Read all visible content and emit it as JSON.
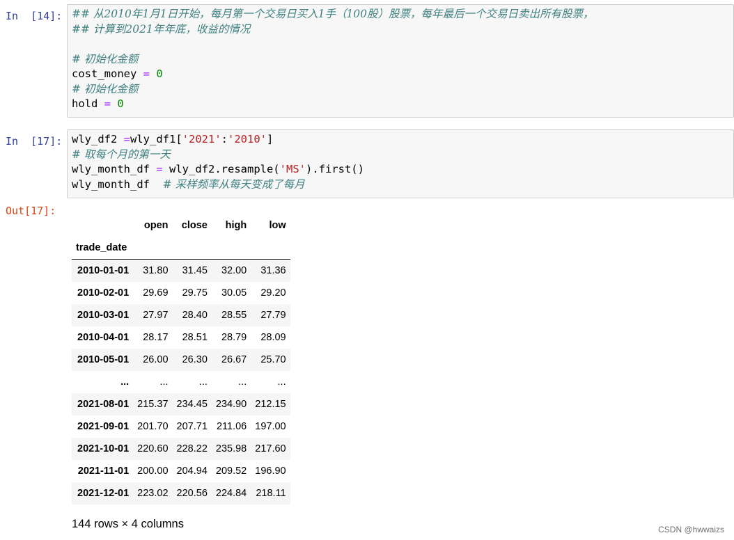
{
  "cell14": {
    "prompt": "In  [14]:",
    "lines": [
      [
        {
          "t": "## 从2010年1月1日开始，每月第一个交易日买入1手（100股）股票，每年最后一个交易日卖出所有股票，",
          "c": "cm-comment"
        }
      ],
      [
        {
          "t": "## 计算到2021年年底，收益的情况",
          "c": "cm-comment"
        }
      ],
      [],
      [
        {
          "t": "# 初始化金额",
          "c": "cm-comment"
        }
      ],
      [
        {
          "t": "cost_money ",
          "c": ""
        },
        {
          "t": "=",
          "c": "cm-op"
        },
        {
          "t": " ",
          "c": ""
        },
        {
          "t": "0",
          "c": "cm-num"
        }
      ],
      [
        {
          "t": "# 初始化金额",
          "c": "cm-comment"
        }
      ],
      [
        {
          "t": "hold ",
          "c": ""
        },
        {
          "t": "=",
          "c": "cm-op"
        },
        {
          "t": " ",
          "c": ""
        },
        {
          "t": "0",
          "c": "cm-num"
        }
      ]
    ]
  },
  "cell17": {
    "prompt": "In  [17]:",
    "out_prompt": "Out[17]:",
    "lines": [
      [
        {
          "t": "wly_df2 ",
          "c": ""
        },
        {
          "t": "=",
          "c": "cm-op"
        },
        {
          "t": "wly_df1[",
          "c": ""
        },
        {
          "t": "'2021'",
          "c": "cm-str"
        },
        {
          "t": ":",
          "c": ""
        },
        {
          "t": "'2010'",
          "c": "cm-str"
        },
        {
          "t": "]",
          "c": ""
        }
      ],
      [
        {
          "t": "# 取每个月的第一天",
          "c": "cm-comment"
        }
      ],
      [
        {
          "t": "wly_month_df ",
          "c": ""
        },
        {
          "t": "=",
          "c": "cm-op"
        },
        {
          "t": " wly_df2.resample(",
          "c": ""
        },
        {
          "t": "'MS'",
          "c": "cm-str"
        },
        {
          "t": ").first()",
          "c": ""
        }
      ],
      [
        {
          "t": "wly_month_df  ",
          "c": ""
        },
        {
          "t": "# 采样频率从每天变成了每月",
          "c": "cm-comment"
        }
      ]
    ]
  },
  "dataframe": {
    "columns": [
      "open",
      "close",
      "high",
      "low"
    ],
    "index_name": "trade_date",
    "rows": [
      [
        "2010-01-01",
        "31.80",
        "31.45",
        "32.00",
        "31.36"
      ],
      [
        "2010-02-01",
        "29.69",
        "29.75",
        "30.05",
        "29.20"
      ],
      [
        "2010-03-01",
        "27.97",
        "28.40",
        "28.55",
        "27.79"
      ],
      [
        "2010-04-01",
        "28.17",
        "28.51",
        "28.79",
        "28.09"
      ],
      [
        "2010-05-01",
        "26.00",
        "26.30",
        "26.67",
        "25.70"
      ],
      [
        "...",
        "...",
        "...",
        "...",
        "..."
      ],
      [
        "2021-08-01",
        "215.37",
        "234.45",
        "234.90",
        "212.15"
      ],
      [
        "2021-09-01",
        "201.70",
        "207.71",
        "211.06",
        "197.00"
      ],
      [
        "2021-10-01",
        "220.60",
        "228.22",
        "235.98",
        "217.60"
      ],
      [
        "2021-11-01",
        "200.00",
        "204.94",
        "209.52",
        "196.90"
      ],
      [
        "2021-12-01",
        "223.02",
        "220.56",
        "224.84",
        "218.11"
      ]
    ],
    "summary": "144 rows × 4 columns"
  },
  "watermark": "CSDN @hwwaizs"
}
